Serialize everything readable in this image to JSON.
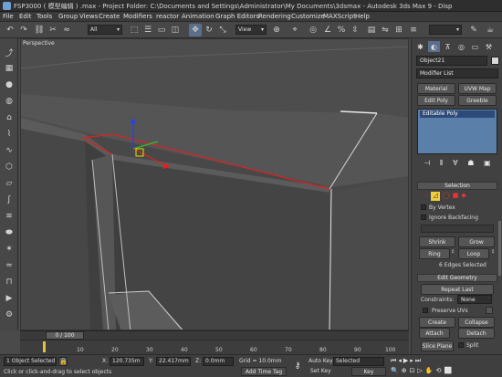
{
  "window": {
    "title": "FSP3000 ( 模型编辑 ) .max   - Project Folder: C:\\Documents and Settings\\Administrator\\My Documents\\3dsmax   - Autodesk 3ds Max 9    - Disp"
  },
  "menu": {
    "items": [
      "File",
      "Edit",
      "Tools",
      "Group",
      "Views",
      "Create",
      "Modifiers",
      "reactor",
      "Animation",
      "Graph Editors",
      "Rendering",
      "Customize",
      "MAXScript",
      "Help"
    ]
  },
  "toolbar": {
    "selection_filter": "All",
    "reference_coord": "View"
  },
  "viewport": {
    "label": "Perspective"
  },
  "command_panel": {
    "object_name": "Object21",
    "modifier_list": "Modifier List",
    "buttons": {
      "material": "Material",
      "uvw_map": "UVW Map",
      "edit_poly": "Edit Poly",
      "greeble": "Greeble"
    },
    "stack_item": "Editable Poly",
    "selection": {
      "header": "Selection",
      "by_vertex": "By Vertex",
      "ignore_backfacing": "Ignore Backfacing",
      "shrink": "Shrink",
      "grow": "Grow",
      "ring": "Ring",
      "loop": "Loop",
      "status": "6 Edges Selected"
    },
    "edit_geometry": {
      "header": "Edit Geometry",
      "repeat_last": "Repeat Last",
      "constraints_label": "Constraints:",
      "constraints_value": "None",
      "preserve_uvs": "Preserve UVs",
      "create": "Create",
      "collapse": "Collapse",
      "attach": "Attach",
      "detach": "Detach",
      "slice_plane": "Slice Plane",
      "split": "Split"
    }
  },
  "timeline": {
    "frame_display": "0 / 100",
    "ticks": [
      "10",
      "20",
      "30",
      "40",
      "50",
      "60",
      "70",
      "80",
      "90",
      "100"
    ]
  },
  "statusbar": {
    "selection_info": "1 Object Selected",
    "prompt": "Click or click-and-drag to select objects",
    "x_label": "X:",
    "x_value": "120.735m",
    "y_label": "Y:",
    "y_value": "22.417mm",
    "z_label": "Z:",
    "z_value": "0.0mm",
    "grid": "Grid = 10.0mm",
    "add_time_tag": "Add Time Tag",
    "auto_key": "Auto Key",
    "auto_key_value": "Selected",
    "set_key": "Set Key",
    "key_filters": "Key Filters..."
  },
  "colors": {
    "viewport_bg": "#484848",
    "selected_edge": "#e02020",
    "stack_highlight": "#5a7fa8"
  }
}
